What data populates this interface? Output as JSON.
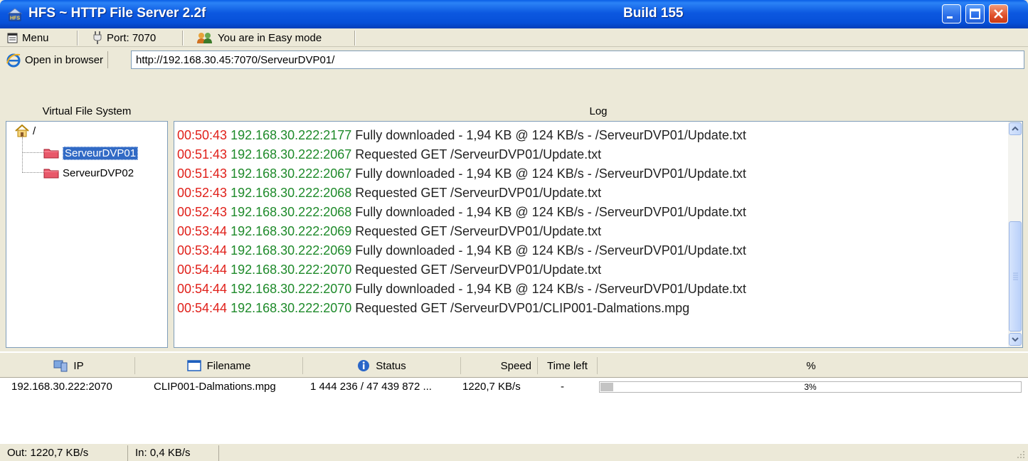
{
  "window": {
    "title": "HFS ~ HTTP File Server 2.2f",
    "build": "Build 155",
    "app_icon_text": "HFS"
  },
  "menubar": {
    "menu_label": "Menu",
    "port_label": "Port: 7070",
    "mode_label": "You are in Easy mode"
  },
  "addressbar": {
    "open_label": "Open in browser",
    "url": "http://192.168.30.45:7070/ServeurDVP01/"
  },
  "panels": {
    "vfs_title": "Virtual File System",
    "log_title": "Log"
  },
  "vfs": {
    "root": "/",
    "items": [
      {
        "label": "ServeurDVP01",
        "selected": true
      },
      {
        "label": "ServeurDVP02",
        "selected": false
      }
    ]
  },
  "log": {
    "entries": [
      {
        "time": "00:50:43",
        "ip": "192.168.30.222:2177",
        "msg": "Fully downloaded - 1,94 KB @ 124 KB/s - /ServeurDVP01/Update.txt"
      },
      {
        "time": "00:51:43",
        "ip": "192.168.30.222:2067",
        "msg": "Requested GET /ServeurDVP01/Update.txt"
      },
      {
        "time": "00:51:43",
        "ip": "192.168.30.222:2067",
        "msg": "Fully downloaded - 1,94 KB @ 124 KB/s - /ServeurDVP01/Update.txt"
      },
      {
        "time": "00:52:43",
        "ip": "192.168.30.222:2068",
        "msg": "Requested GET /ServeurDVP01/Update.txt"
      },
      {
        "time": "00:52:43",
        "ip": "192.168.30.222:2068",
        "msg": "Fully downloaded - 1,94 KB @ 124 KB/s - /ServeurDVP01/Update.txt"
      },
      {
        "time": "00:53:44",
        "ip": "192.168.30.222:2069",
        "msg": "Requested GET /ServeurDVP01/Update.txt"
      },
      {
        "time": "00:53:44",
        "ip": "192.168.30.222:2069",
        "msg": "Fully downloaded - 1,94 KB @ 124 KB/s - /ServeurDVP01/Update.txt"
      },
      {
        "time": "00:54:44",
        "ip": "192.168.30.222:2070",
        "msg": "Requested GET /ServeurDVP01/Update.txt"
      },
      {
        "time": "00:54:44",
        "ip": "192.168.30.222:2070",
        "msg": "Fully downloaded - 1,94 KB @ 124 KB/s - /ServeurDVP01/Update.txt"
      },
      {
        "time": "00:54:44",
        "ip": "192.168.30.222:2070",
        "msg": "Requested GET /ServeurDVP01/CLIP001-Dalmations.mpg"
      }
    ]
  },
  "transfers": {
    "columns": {
      "ip": "IP",
      "filename": "Filename",
      "status": "Status",
      "speed": "Speed",
      "time_left": "Time left",
      "percent": "%"
    },
    "rows": [
      {
        "ip": "192.168.30.222:2070",
        "filename": "CLIP001-Dalmations.mpg",
        "status": "1 444 236 / 47 439 872 ...",
        "speed": "1220,7 KB/s",
        "time_left": "-",
        "percent_label": "3%",
        "percent_value": 3
      }
    ]
  },
  "statusbar": {
    "out": "Out: 1220,7 KB/s",
    "in": "In: 0,4 KB/s"
  },
  "colors": {
    "log_time": "#e0201a",
    "log_ip": "#1e8a2a",
    "selection": "#316ac5",
    "titlebar": "#0750d8"
  }
}
